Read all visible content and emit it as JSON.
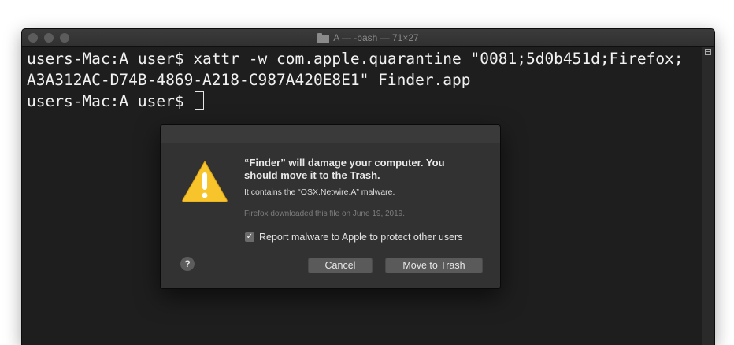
{
  "window": {
    "title": "A — -bash — 71×27"
  },
  "terminal": {
    "lines": [
      "users-Mac:A user$ xattr -w com.apple.quarantine \"0081;5d0b451d;Firefox;",
      "A3A312AC-D74B-4869-A218-C987A420E8E1\" Finder.app",
      "users-Mac:A user$ "
    ]
  },
  "dialog": {
    "title": "“Finder” will damage your computer. You should move it to the Trash.",
    "body": "It contains the “OSX.Netwire.A” malware.",
    "info": "Firefox downloaded this file on June 19, 2019.",
    "checkbox_label": "Report malware to Apple to protect other users",
    "checkbox_checked": true,
    "check_glyph": "✓",
    "help_glyph": "?",
    "cancel_label": "Cancel",
    "trash_label": "Move to Trash"
  },
  "colors": {
    "terminal_bg": "#1e1e1e",
    "dialog_bg": "#323232",
    "warning_yellow": "#f7c52b"
  },
  "icons": {
    "titlebar": "folder-icon",
    "dialog": "warning-icon",
    "scrollbar": "split-view-icon"
  }
}
